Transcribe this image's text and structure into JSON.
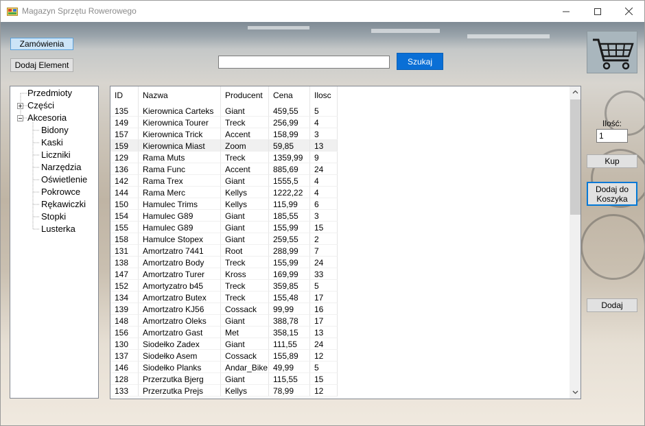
{
  "window": {
    "title": "Magazyn Sprzętu Rowerowego"
  },
  "toolbar": {
    "orders_label": "Zamówienia",
    "add_element_label": "Dodaj Element",
    "search_label": "Szukaj",
    "search_value": ""
  },
  "tree": {
    "root": "Przedmioty",
    "parts": "Części",
    "accessories": "Akcesoria",
    "children": [
      "Bidony",
      "Kaski",
      "Liczniki",
      "Narzędzia",
      "Oświetlenie",
      "Pokrowce",
      "Rękawiczki",
      "Stopki",
      "Lusterka"
    ]
  },
  "grid": {
    "columns": [
      "ID",
      "Nazwa",
      "Producent",
      "Cena",
      "Ilosc"
    ],
    "rows": [
      [
        "135",
        "Kierownica Carteks",
        "Giant",
        "459,55",
        "5"
      ],
      [
        "149",
        "Kierownica Tourer",
        "Treck",
        "256,99",
        "4"
      ],
      [
        "157",
        "Kierownica Trick",
        "Accent",
        "158,99",
        "3"
      ],
      [
        "159",
        "Kierownica Miast",
        "Zoom",
        "59,85",
        "13"
      ],
      [
        "129",
        "Rama Muts",
        "Treck",
        "1359,99",
        "9"
      ],
      [
        "136",
        "Rama Func",
        "Accent",
        "885,69",
        "24"
      ],
      [
        "142",
        "Rama Trex",
        "Giant",
        "1555,5",
        "4"
      ],
      [
        "144",
        "Rama Merc",
        "Kellys",
        "1222,22",
        "4"
      ],
      [
        "150",
        "Hamulec Trims",
        "Kellys",
        "115,99",
        "6"
      ],
      [
        "154",
        "Hamulec G89",
        "Giant",
        "185,55",
        "3"
      ],
      [
        "155",
        "Hamulec G89",
        "Giant",
        "155,99",
        "15"
      ],
      [
        "158",
        "Hamulce Stopex",
        "Giant",
        "259,55",
        "2"
      ],
      [
        "131",
        "Amortzatro 7441",
        "Root",
        "288,99",
        "7"
      ],
      [
        "138",
        "Amortzatro Body",
        "Treck",
        "155,99",
        "24"
      ],
      [
        "147",
        "Amortzatro Turer",
        "Kross",
        "169,99",
        "33"
      ],
      [
        "152",
        "Amortyzatro b45",
        "Treck",
        "359,85",
        "5"
      ],
      [
        "134",
        "Amortzatro Butex",
        "Treck",
        "155,48",
        "17"
      ],
      [
        "139",
        "Amortzatro KJ56",
        "Cossack",
        "99,99",
        "16"
      ],
      [
        "148",
        "Amortzatro Oleks",
        "Giant",
        "388,78",
        "17"
      ],
      [
        "156",
        "Amortzatro Gast",
        "Met",
        "358,15",
        "13"
      ],
      [
        "130",
        "Siodełko Zadex",
        "Giant",
        "111,55",
        "24"
      ],
      [
        "137",
        "Siodełko Asem",
        "Cossack",
        "155,89",
        "12"
      ],
      [
        "146",
        "Siodełko Planks",
        "Andar_Bike",
        "49,99",
        "5"
      ],
      [
        "128",
        "Przerzutka Bjerg",
        "Giant",
        "115,55",
        "15"
      ],
      [
        "133",
        "Przerzutka Prejs",
        "Kellys",
        "78,99",
        "12"
      ]
    ],
    "selected_row_id": "159"
  },
  "side": {
    "qty_label": "Ilość:",
    "qty_value": "1",
    "buy_label": "Kup",
    "add_to_cart_line1": "Dodaj do",
    "add_to_cart_line2": "Koszyka",
    "add_label": "Dodaj"
  },
  "colors": {
    "accent": "#0a6fd6",
    "selected_button": "#cce4f7"
  },
  "icons": [
    "app-icon",
    "minimize-icon",
    "maximize-icon",
    "close-icon",
    "cart-icon",
    "tree-expand-icon",
    "tree-collapse-icon",
    "scroll-up-icon",
    "scroll-down-icon"
  ]
}
